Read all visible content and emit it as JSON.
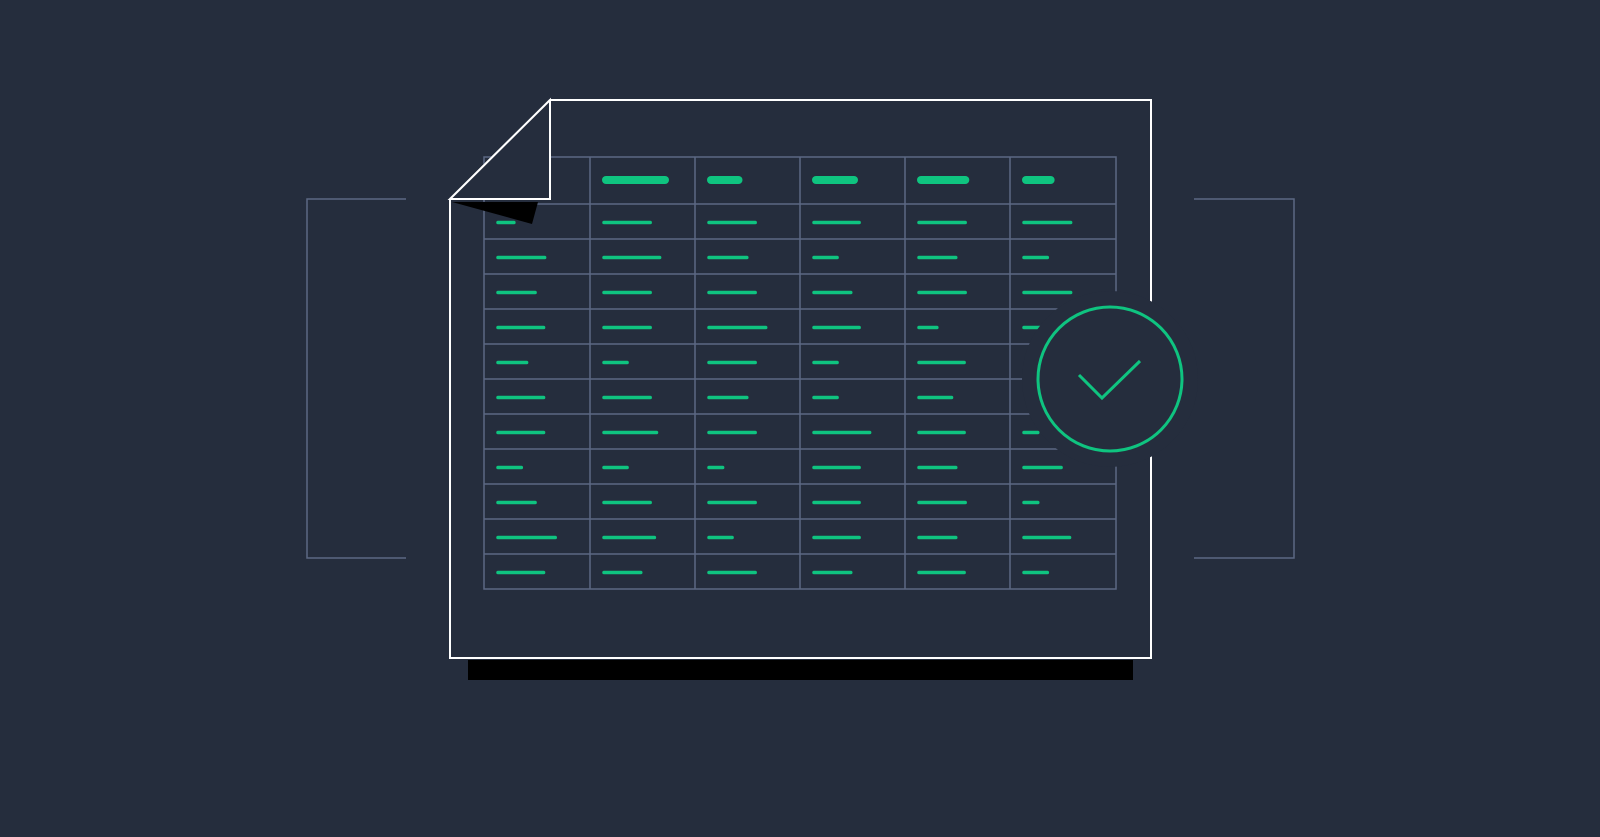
{
  "colors": {
    "background": "#252d3d",
    "page_outline": "#ffffff",
    "shadow": "#000000",
    "grid_line": "#5c6883",
    "bracket": "#5c6883",
    "accent": "#0fc480"
  },
  "icons": {
    "document": "spreadsheet-document-icon",
    "validation": "check-circle-icon"
  },
  "table": {
    "columns": 6,
    "body_rows": 11,
    "header_cells_filled": [
      false,
      true,
      true,
      true,
      true,
      true
    ],
    "header_bar_fill": [
      0,
      0.6,
      0.3,
      0.4,
      0.46,
      0.27
    ],
    "row_bar_fill": [
      [
        0.15,
        0.44,
        0.44,
        0.43,
        0.44,
        0.44
      ],
      [
        0.44,
        0.53,
        0.36,
        0.22,
        0.35,
        0.22
      ],
      [
        0.35,
        0.44,
        0.44,
        0.35,
        0.44,
        0.44
      ],
      [
        0.43,
        0.44,
        0.54,
        0.43,
        0.17,
        0.27
      ],
      [
        0.27,
        0.22,
        0.44,
        0.22,
        0.43,
        0.0
      ],
      [
        0.43,
        0.44,
        0.36,
        0.22,
        0.31,
        0.0
      ],
      [
        0.43,
        0.5,
        0.44,
        0.53,
        0.43,
        0.13
      ],
      [
        0.22,
        0.22,
        0.13,
        0.43,
        0.35,
        0.35
      ],
      [
        0.35,
        0.44,
        0.44,
        0.43,
        0.44,
        0.13
      ],
      [
        0.54,
        0.48,
        0.22,
        0.43,
        0.35,
        0.43
      ],
      [
        0.43,
        0.35,
        0.44,
        0.35,
        0.43,
        0.22
      ]
    ]
  }
}
